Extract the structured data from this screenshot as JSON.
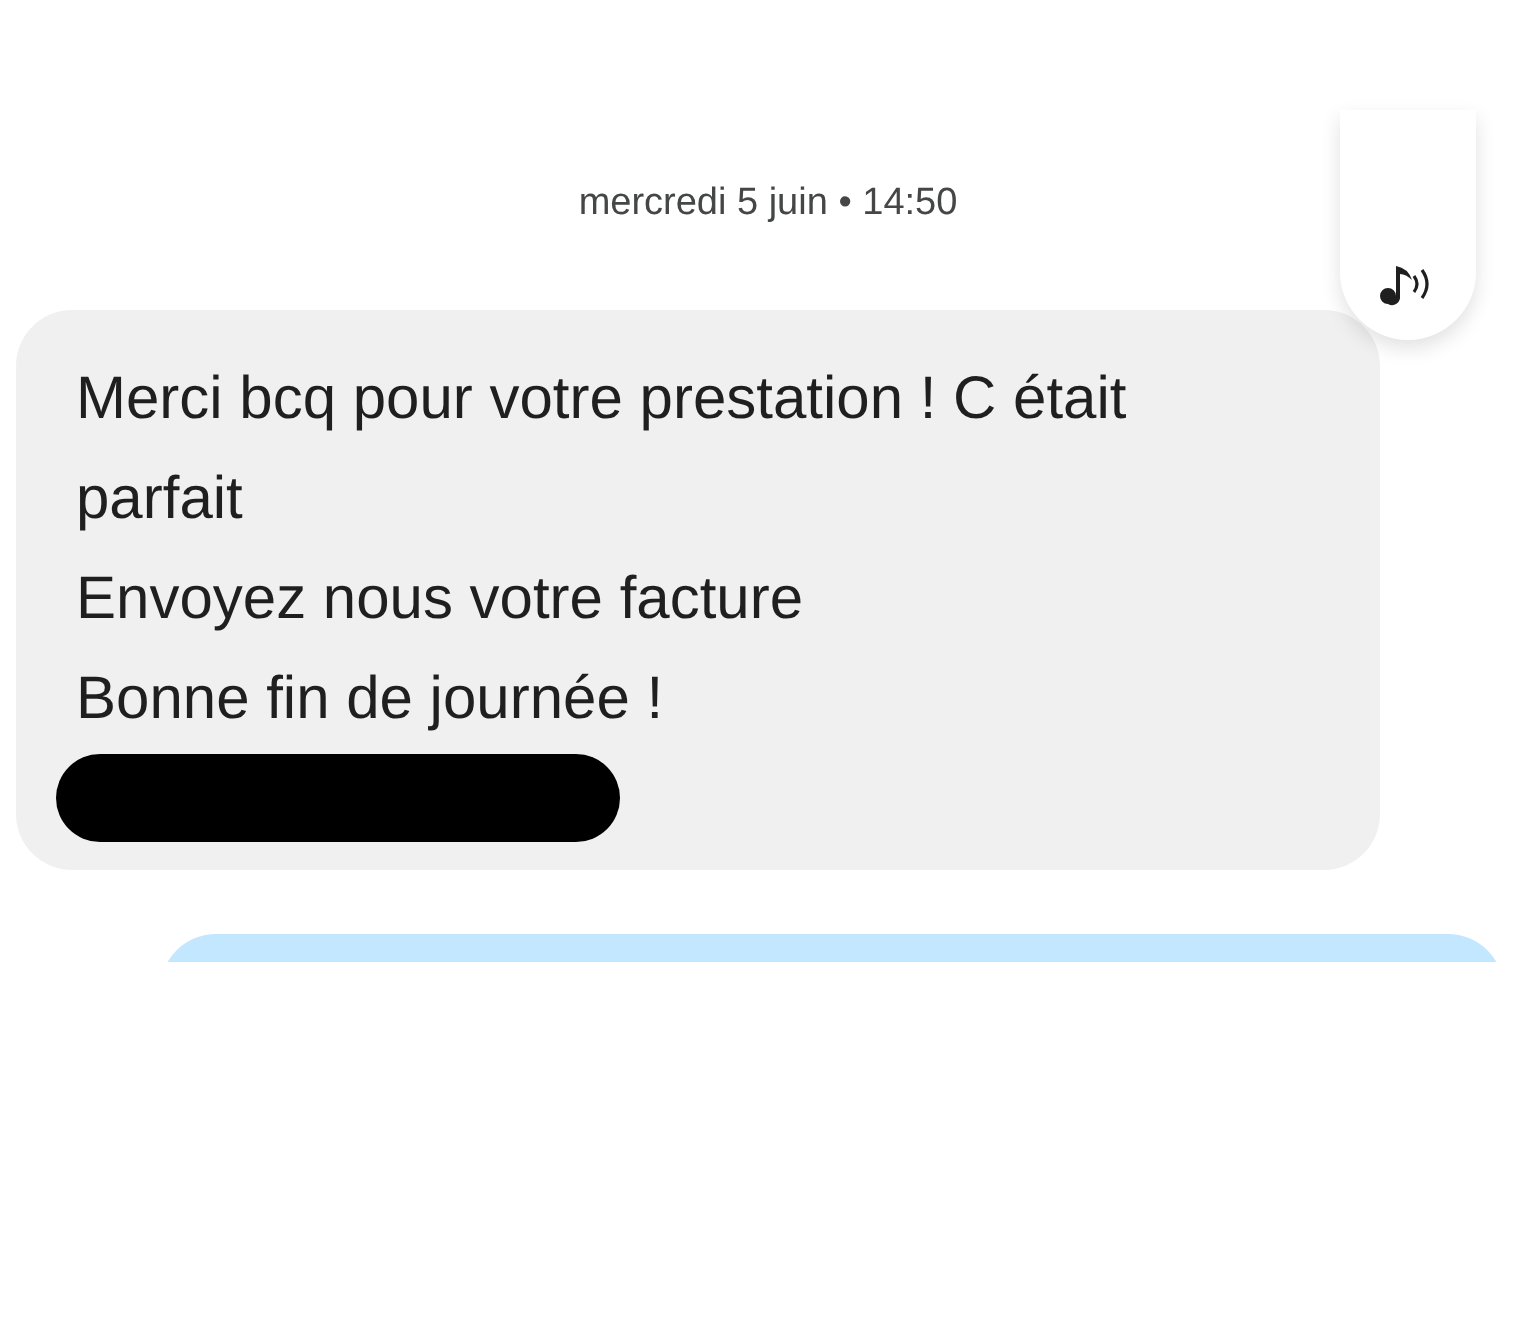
{
  "timestamp": "mercredi 5 juin • 14:50",
  "message": {
    "lines": [
      "Merci bcq pour votre prestation ! C était parfait",
      "Envoyez nous votre facture",
      "Bonne fin de journée !"
    ],
    "redacted": true
  }
}
